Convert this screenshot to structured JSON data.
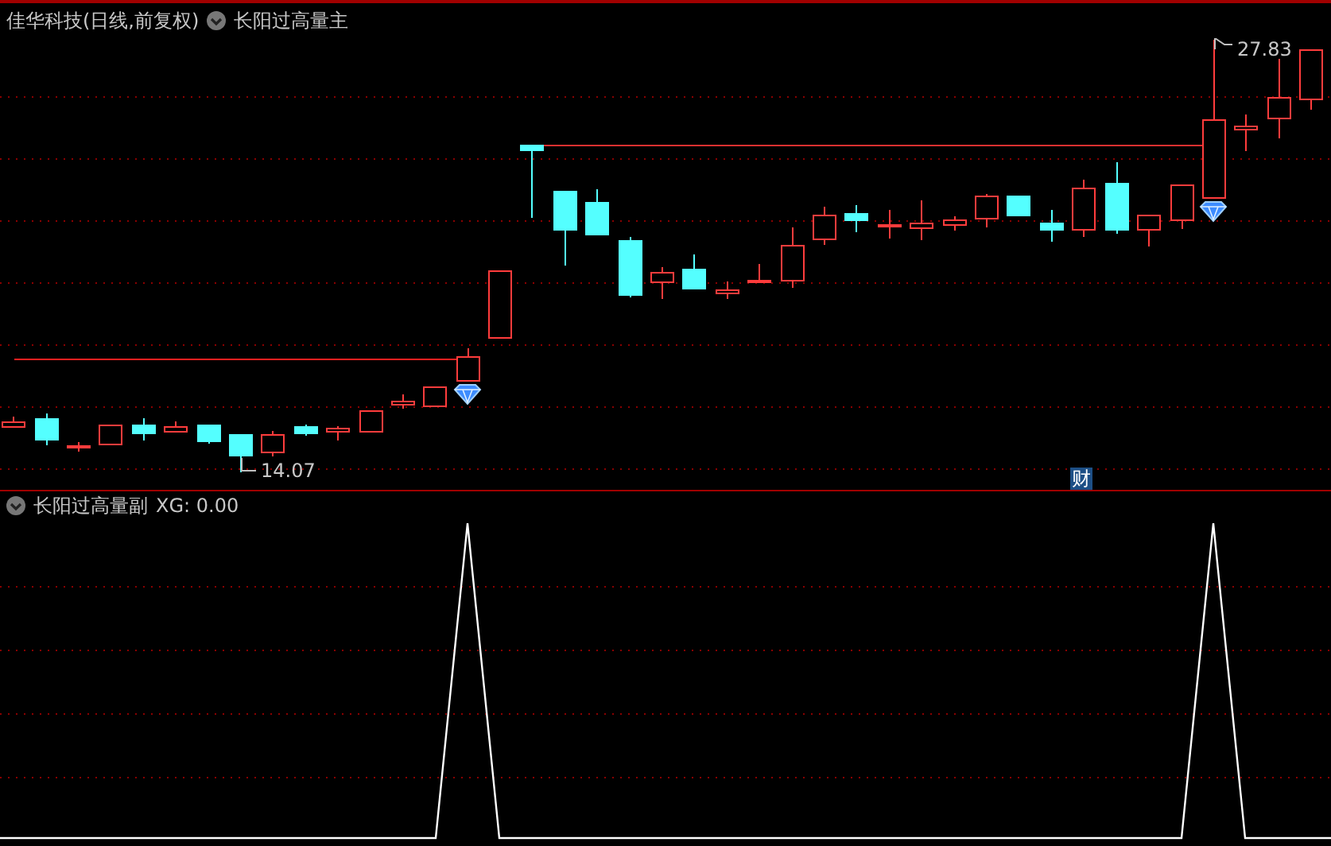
{
  "main_panel": {
    "title": "佳华科技(日线,前复权)",
    "indicator": "长阳过高量主",
    "high_label": "27.83",
    "low_label": "14.07",
    "badge": "财"
  },
  "sub_panel": {
    "indicator": "长阳过高量副",
    "reading": "XG: 0.00"
  }
}
